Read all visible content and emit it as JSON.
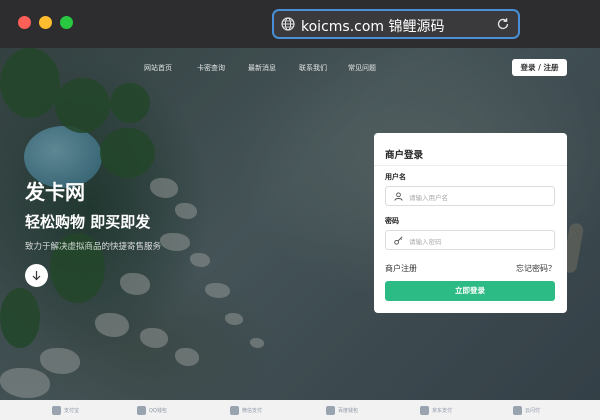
{
  "browser": {
    "url": "koicms.com 锦鲤源码"
  },
  "nav": {
    "items": [
      "网站首页",
      "卡密查询",
      "最新消息",
      "联系我们",
      "常见问题"
    ],
    "login_label": "登录 / 注册"
  },
  "hero": {
    "title": "发卡网",
    "subtitle": "轻松购物 即买即发",
    "description": "致力于解决虚拟商品的快捷寄售服务"
  },
  "login": {
    "title": "商户登录",
    "username_label": "用户名",
    "username_placeholder": "请输入用户名",
    "password_label": "密码",
    "password_placeholder": "请输入密码",
    "register_link": "商户注册",
    "forgot_link": "忘记密码？",
    "submit_label": "立即登录"
  },
  "partners": [
    "支付宝",
    "QQ钱包",
    "微信支付",
    "百度钱包",
    "京东支付",
    "云闪付"
  ],
  "colors": {
    "accent": "#2dbb85",
    "url_focus": "#4a8fd6"
  }
}
